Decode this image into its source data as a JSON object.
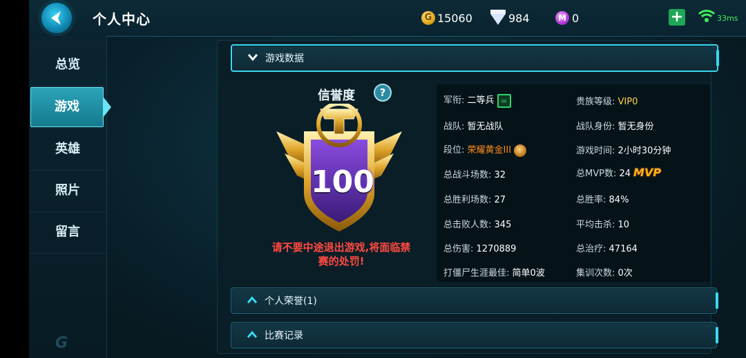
{
  "header": {
    "title": "个人中心",
    "gold": "15060",
    "gold_symbol": "G",
    "diamonds": "984",
    "m_coins": "0",
    "m_symbol": "M",
    "plus": "+",
    "ping": "33ms"
  },
  "sidebar": {
    "items": [
      {
        "label": "总览"
      },
      {
        "label": "游戏"
      },
      {
        "label": "英雄"
      },
      {
        "label": "照片"
      },
      {
        "label": "留言"
      }
    ],
    "active_index": 1,
    "logo": "G"
  },
  "sections": {
    "game_data": "游戏数据",
    "personal_honor": "个人荣誉(1)",
    "match_records": "比赛记录"
  },
  "credit": {
    "title": "信誉度",
    "help": "?",
    "score": "100",
    "warning": "请不要中途退出游戏,将面临禁赛的处罚!"
  },
  "stats": {
    "rank_label": "军衔:",
    "rank_value": "二等兵",
    "rank_badge": "=",
    "noble_label": "贵族等级:",
    "noble_value": "VIP0",
    "team_label": "战队:",
    "team_value": "暂无战队",
    "team_role_label": "战队身份:",
    "team_role_value": "暂无身份",
    "tier_label": "段位:",
    "tier_value": "荣耀黄金III",
    "playtime_label": "游戏时间:",
    "playtime_value": "2小时30分钟",
    "battles_label": "总战斗场数:",
    "battles_value": "32",
    "mvp_label": "总MVP数:",
    "mvp_value": "24",
    "mvp_tag": "MVP",
    "wins_label": "总胜利场数:",
    "wins_value": "27",
    "winrate_label": "总胜率:",
    "winrate_value": "84%",
    "kills_label": "总击败人数:",
    "kills_value": "345",
    "avgkills_label": "平均击杀:",
    "avgkills_value": "10",
    "damage_label": "总伤害:",
    "damage_value": "1270889",
    "heal_label": "总治疗:",
    "heal_value": "47164",
    "zombie_label": "打僵尸生涯最佳:",
    "zombie_value": "简单0波",
    "training_label": "集训次数:",
    "training_value": "0次"
  },
  "colors": {
    "accent": "#3ad8f0",
    "warning": "#ff4a40",
    "tier": "#ff8a1a",
    "noble": "#ffd24a"
  }
}
